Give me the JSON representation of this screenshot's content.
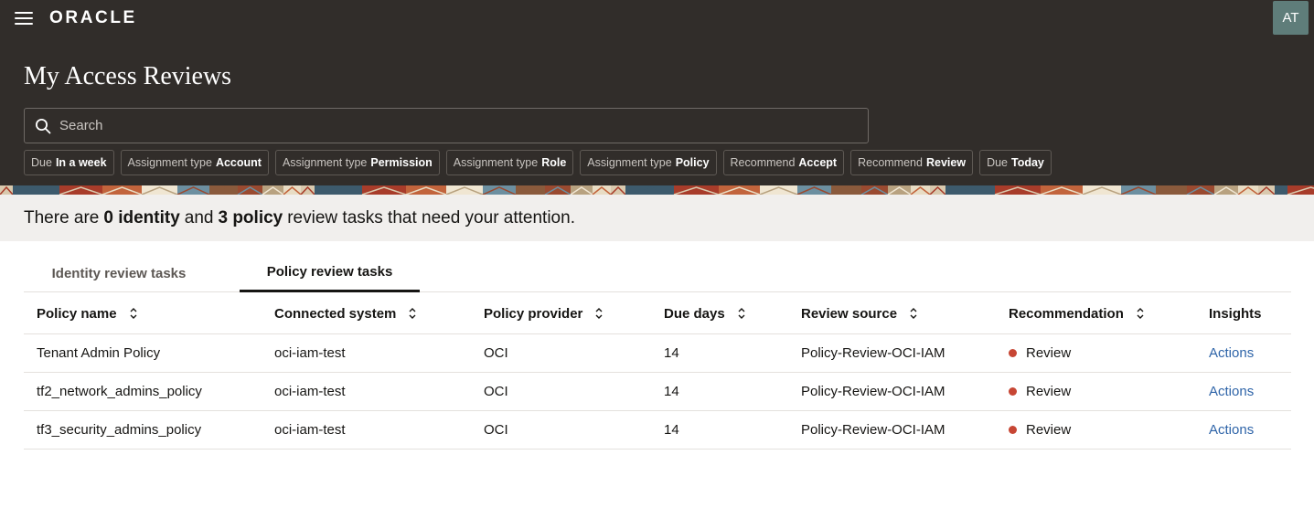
{
  "header": {
    "logo_text": "ORACLE",
    "avatar_initials": "AT",
    "page_title": "My Access Reviews",
    "search_placeholder": "Search",
    "filters": [
      {
        "key": "Due",
        "value": "In a week"
      },
      {
        "key": "Assignment type",
        "value": "Account"
      },
      {
        "key": "Assignment type",
        "value": "Permission"
      },
      {
        "key": "Assignment type",
        "value": "Role"
      },
      {
        "key": "Assignment type",
        "value": "Policy"
      },
      {
        "key": "Recommend",
        "value": "Accept"
      },
      {
        "key": "Recommend",
        "value": "Review"
      },
      {
        "key": "Due",
        "value": "Today"
      }
    ]
  },
  "banner": {
    "prefix": "There are",
    "identity_count": "0 identity",
    "middle": "and",
    "policy_count": "3 policy",
    "suffix": "review tasks that need your attention."
  },
  "tabs": [
    {
      "label": "Identity review tasks",
      "selected": false
    },
    {
      "label": "Policy review tasks",
      "selected": true
    }
  ],
  "table": {
    "columns": [
      "Policy name",
      "Connected system",
      "Policy provider",
      "Due days",
      "Review source",
      "Recommendation",
      "Insights"
    ],
    "rows": [
      {
        "policy_name": "Tenant Admin Policy",
        "connected_system": "oci-iam-test",
        "policy_provider": "OCI",
        "due_days": "14",
        "review_source": "Policy-Review-OCI-IAM",
        "recommendation": "Review",
        "insights": "Actions"
      },
      {
        "policy_name": "tf2_network_admins_policy",
        "connected_system": "oci-iam-test",
        "policy_provider": "OCI",
        "due_days": "14",
        "review_source": "Policy-Review-OCI-IAM",
        "recommendation": "Review",
        "insights": "Actions"
      },
      {
        "policy_name": "tf3_security_admins_policy",
        "connected_system": "oci-iam-test",
        "policy_provider": "OCI",
        "due_days": "14",
        "review_source": "Policy-Review-OCI-IAM",
        "recommendation": "Review",
        "insights": "Actions"
      }
    ]
  },
  "colors": {
    "header_bg": "#312d2a",
    "banner_bg": "#f1efed",
    "recommend_review_dot": "#c74634",
    "link": "#2e64a8"
  }
}
